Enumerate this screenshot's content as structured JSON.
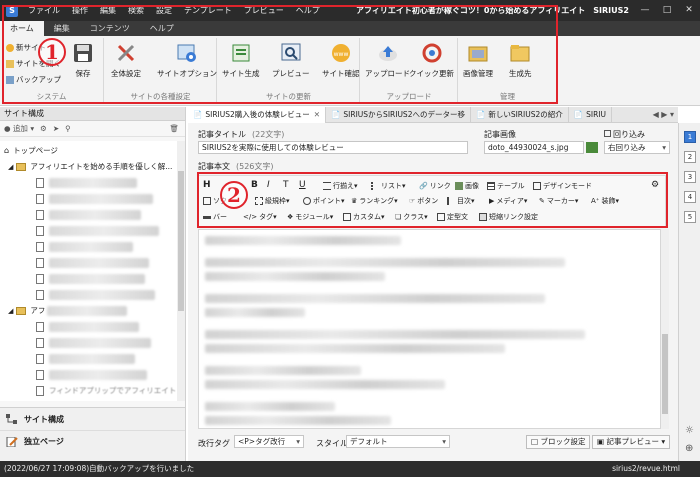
{
  "window": {
    "title": "アフィリエイト初心者が稼ぐコツ！0から始めるアフィリエイト　SIRIUS2",
    "app_icon": "S",
    "menu": [
      "ファイル",
      "操作",
      "編集",
      "検索",
      "設定",
      "テンプレート",
      "プレビュー",
      "ヘルプ"
    ]
  },
  "ribbon_tabs": [
    "ホーム",
    "編集",
    "コンテンツ",
    "ヘルプ"
  ],
  "ribbon": {
    "system": {
      "label": "システム",
      "small": [
        "新サイト",
        "サイトを開く",
        "バックアップ"
      ],
      "save": "保存"
    },
    "site_settings": {
      "label": "サイトの各種設定",
      "buttons": [
        "全体設定",
        "サイトオプション"
      ]
    },
    "site_update": {
      "label": "サイトの更新",
      "buttons": [
        "サイト生成",
        "プレビュー",
        "サイト確認"
      ]
    },
    "upload": {
      "label": "アップロード",
      "buttons": [
        "アップロード",
        "クイック更新"
      ]
    },
    "manage": {
      "label": "管理",
      "buttons": [
        "画像管理",
        "生成先"
      ]
    }
  },
  "annotations": {
    "one": "1",
    "two": "2"
  },
  "left_panel": {
    "header": "サイト構成",
    "tools": {
      "add": "追加"
    },
    "tree": {
      "top": "トップページ",
      "category1": "アフィリエイトを始める手順を優しく解...",
      "category2": "アフ",
      "last_item": "フィンドアプリップでアフィリエイト"
    },
    "bottom": [
      "サイト構成",
      "独立ページ"
    ]
  },
  "doc_tabs": [
    "SIRIUS2購入後の体験レビュー",
    "SIRIUSからSIRIUS2へのデーター移",
    "新しいSIRIUS2の紹介",
    "SIRIU"
  ],
  "right_rail": [
    "1",
    "2",
    "3",
    "4",
    "5"
  ],
  "editor": {
    "title_label": "記事タイトル",
    "title_count": "(22文字)",
    "title_value": "SIRIUS2を実際に使用しての体験レビュー",
    "image_label": "記事画像",
    "image_value": "doto_44930024_s.jpg",
    "wrap_label": "回り込み",
    "wrap_value": "右回り込み",
    "body_label": "記事本文",
    "body_count": "(526文字)",
    "toolbar_row1": [
      "H",
      "B",
      "I",
      "T",
      "U",
      "行揃え",
      "リスト",
      "リンク",
      "画像",
      "テーブル",
      "デザインモード"
    ],
    "toolbar_row2": [
      "ソク",
      "級規枠",
      "ポイント",
      "ランキング",
      "ボタン",
      "目次",
      "メディア",
      "マーカー",
      "装飾"
    ],
    "toolbar_row3": [
      "バー",
      "タグ",
      "モジュール",
      "カスタム",
      "クラス",
      "定型文",
      "短縮リンク設定"
    ],
    "footer": {
      "newline_label": "改行タグ",
      "newline_value": "<P>タグ改行",
      "style_label": "スタイル",
      "style_value": "デフォルト",
      "block_btn": "ブロック設定",
      "preview_btn": "記事プレビュー"
    }
  },
  "status": {
    "message": "(2022/06/27 17:09:08)自動バックアップを行いました",
    "file": "sirius2/revue.html"
  },
  "colors": {
    "highlight": "#e0242c",
    "accent": "#3a7bd5"
  }
}
